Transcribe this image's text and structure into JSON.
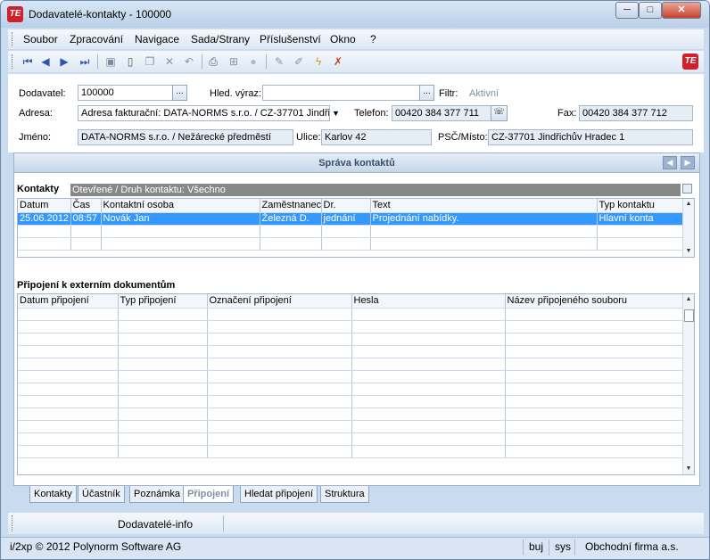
{
  "window": {
    "title": "Dodavatelé-kontakty - 100000",
    "app_icon": "TE",
    "min": "─",
    "max": "□",
    "close": "✕"
  },
  "menu": [
    "Soubor",
    "Zpracování",
    "Navigace",
    "Sada/Strany",
    "Příslušenství",
    "Okno",
    "?"
  ],
  "toolbar": {
    "icons": [
      "first-record-icon",
      "prev-record-icon",
      "next-record-icon",
      "last-record-icon",
      "save-icon",
      "new-icon",
      "copy-icon",
      "delete-icon",
      "undo-icon",
      "print-icon",
      "tree-icon",
      "stop-icon",
      "edit-icon",
      "edit-clear-icon",
      "filter-icon",
      "filter-off-icon"
    ],
    "brand_icon": "TE"
  },
  "form": {
    "dodavatel_label": "Dodavatel:",
    "dodavatel_value": "100000",
    "hled_label": "Hled. výraz:",
    "hled_value": "",
    "filtr_label": "Filtr:",
    "filtr_value": "Aktivní",
    "adresa_label": "Adresa:",
    "adresa_value": "Adresa fakturační: DATA-NORMS s.r.o. / CZ-37701 Jindři",
    "telefon_label": "Telefon:",
    "telefon_value": "00420 384 377 711",
    "fax_label": "Fax:",
    "fax_value": "00420 384 377 712",
    "jmeno_label": "Jméno:",
    "jmeno_value": "DATA-NORMS s.r.o. / Nežárecké předměstí",
    "ulice_label": "Ulice:",
    "ulice_value": "Karlov 42",
    "psc_label": "PSČ/Místo:",
    "psc_value": "CZ-37701 Jindřichův Hradec 1",
    "ellipsis": "..."
  },
  "panel": {
    "title": "Správa kontaktů",
    "prev": "◀",
    "next": "▶"
  },
  "contacts": {
    "section": "Kontakty",
    "filter": "Otevřené / Druh kontaktu: Všechno",
    "columns": [
      "Datum",
      "Čas",
      "Kontaktní osoba",
      "Zaměstnanec",
      "Dr.",
      "Text",
      "Typ kontaktu"
    ],
    "rows": [
      [
        "25.06.2012",
        "08:57",
        "Novák Jan",
        "Železná D.",
        "jednání",
        "Projednání nabídky.",
        "Hlavní konta"
      ]
    ]
  },
  "attachments": {
    "section": "Připojení k externím dokumentům",
    "columns": [
      "Datum připojení",
      "Typ připojení",
      "Označení připojení",
      "Hesla",
      "Název připojeného souboru"
    ]
  },
  "tabs": [
    "Kontakty",
    "Účastník",
    "Poznámka",
    "Připojení",
    "Hledat připojení",
    "Struktura"
  ],
  "active_tab": "Připojení",
  "infobar": {
    "label": "Dodavatelé-info"
  },
  "status": {
    "copyright": "i/2xp © 2012 Polynorm Software AG",
    "user": "buj",
    "sys": "sys",
    "company": "Obchodní firma a.s."
  }
}
